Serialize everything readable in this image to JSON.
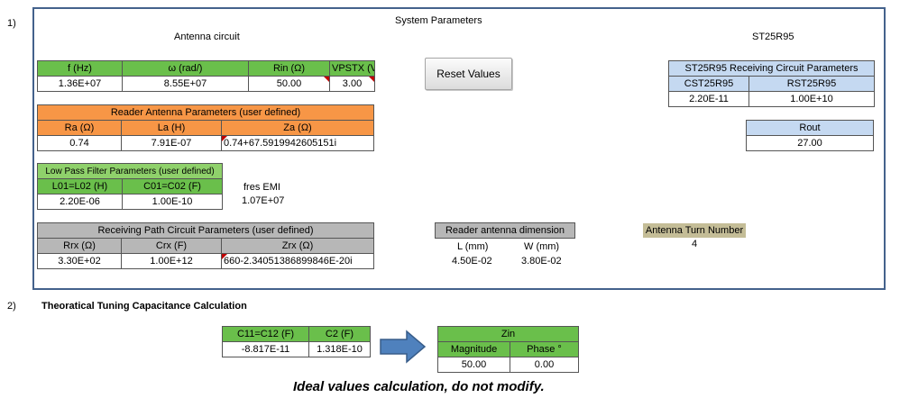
{
  "section1_number": "1)",
  "section2_number": "2)",
  "header": {
    "system_parameters": "System Parameters",
    "antenna_circuit": "Antenna circuit",
    "st25r95": "ST25R95"
  },
  "basic_params": {
    "headers": [
      "f (Hz)",
      "ω (rad/)",
      "Rin (Ω)",
      "VPSTX (V)"
    ],
    "values": [
      "1.36E+07",
      "8.55E+07",
      "50.00",
      "3.00"
    ]
  },
  "reader_antenna": {
    "title": "Reader Antenna Parameters (user defined)",
    "headers": [
      "Ra (Ω)",
      "La (H)",
      "Za  (Ω)"
    ],
    "values": [
      "0.74",
      "7.91E-07",
      "0.74+67.5919942605151i"
    ]
  },
  "low_pass_filter": {
    "title": "Low Pass Filter Parameters (user defined)",
    "headers": [
      "L01=L02 (H)",
      "C01=C02 (F)"
    ],
    "values": [
      "2.20E-06",
      "1.00E-10"
    ]
  },
  "fres_emi": {
    "label": "fres EMI",
    "value": "1.07E+07"
  },
  "receiving_path": {
    "title": "Receiving Path Circuit Parameters (user defined)",
    "headers": [
      "Rrx  (Ω)",
      "Crx (F)",
      "Zrx  (Ω)"
    ],
    "values": [
      "3.30E+02",
      "1.00E+12",
      "660-2.34051386899846E-20i"
    ]
  },
  "reset_button": "Reset Values",
  "reader_antenna_dimension": {
    "title": "Reader antenna dimension",
    "headers": [
      "L (mm)",
      "W (mm)"
    ],
    "values": [
      "4.50E-02",
      "3.80E-02"
    ]
  },
  "antenna_turn": {
    "label": "Antenna Turn Number",
    "value": "4"
  },
  "st25r95_receiving": {
    "title": "ST25R95 Receiving Circuit Parameters",
    "headers": [
      "CST25R95",
      "RST25R95"
    ],
    "values": [
      "2.20E-11",
      "1.00E+10"
    ]
  },
  "rout": {
    "label": "Rout",
    "value": "27.00"
  },
  "tuning": {
    "title": "Theoratical Tuning Capacitance Calculation",
    "headers": [
      "C11=C12 (F)",
      "C2 (F)"
    ],
    "values": [
      "-8.817E-11",
      "1.318E-10"
    ]
  },
  "zin": {
    "title": "Zin",
    "headers": [
      "Magnitude",
      "Phase °"
    ],
    "values": [
      "50.00",
      "0.00"
    ]
  },
  "footer_note": "Ideal values calculation, do not modify.",
  "colors": {
    "green": "#6abf4b",
    "orange": "#f79646",
    "gray": "#b7b7b7",
    "light_blue": "#c5d9f1",
    "tan": "#c4bd97",
    "arrow": "#4f81bd",
    "frame": "#44628c"
  }
}
